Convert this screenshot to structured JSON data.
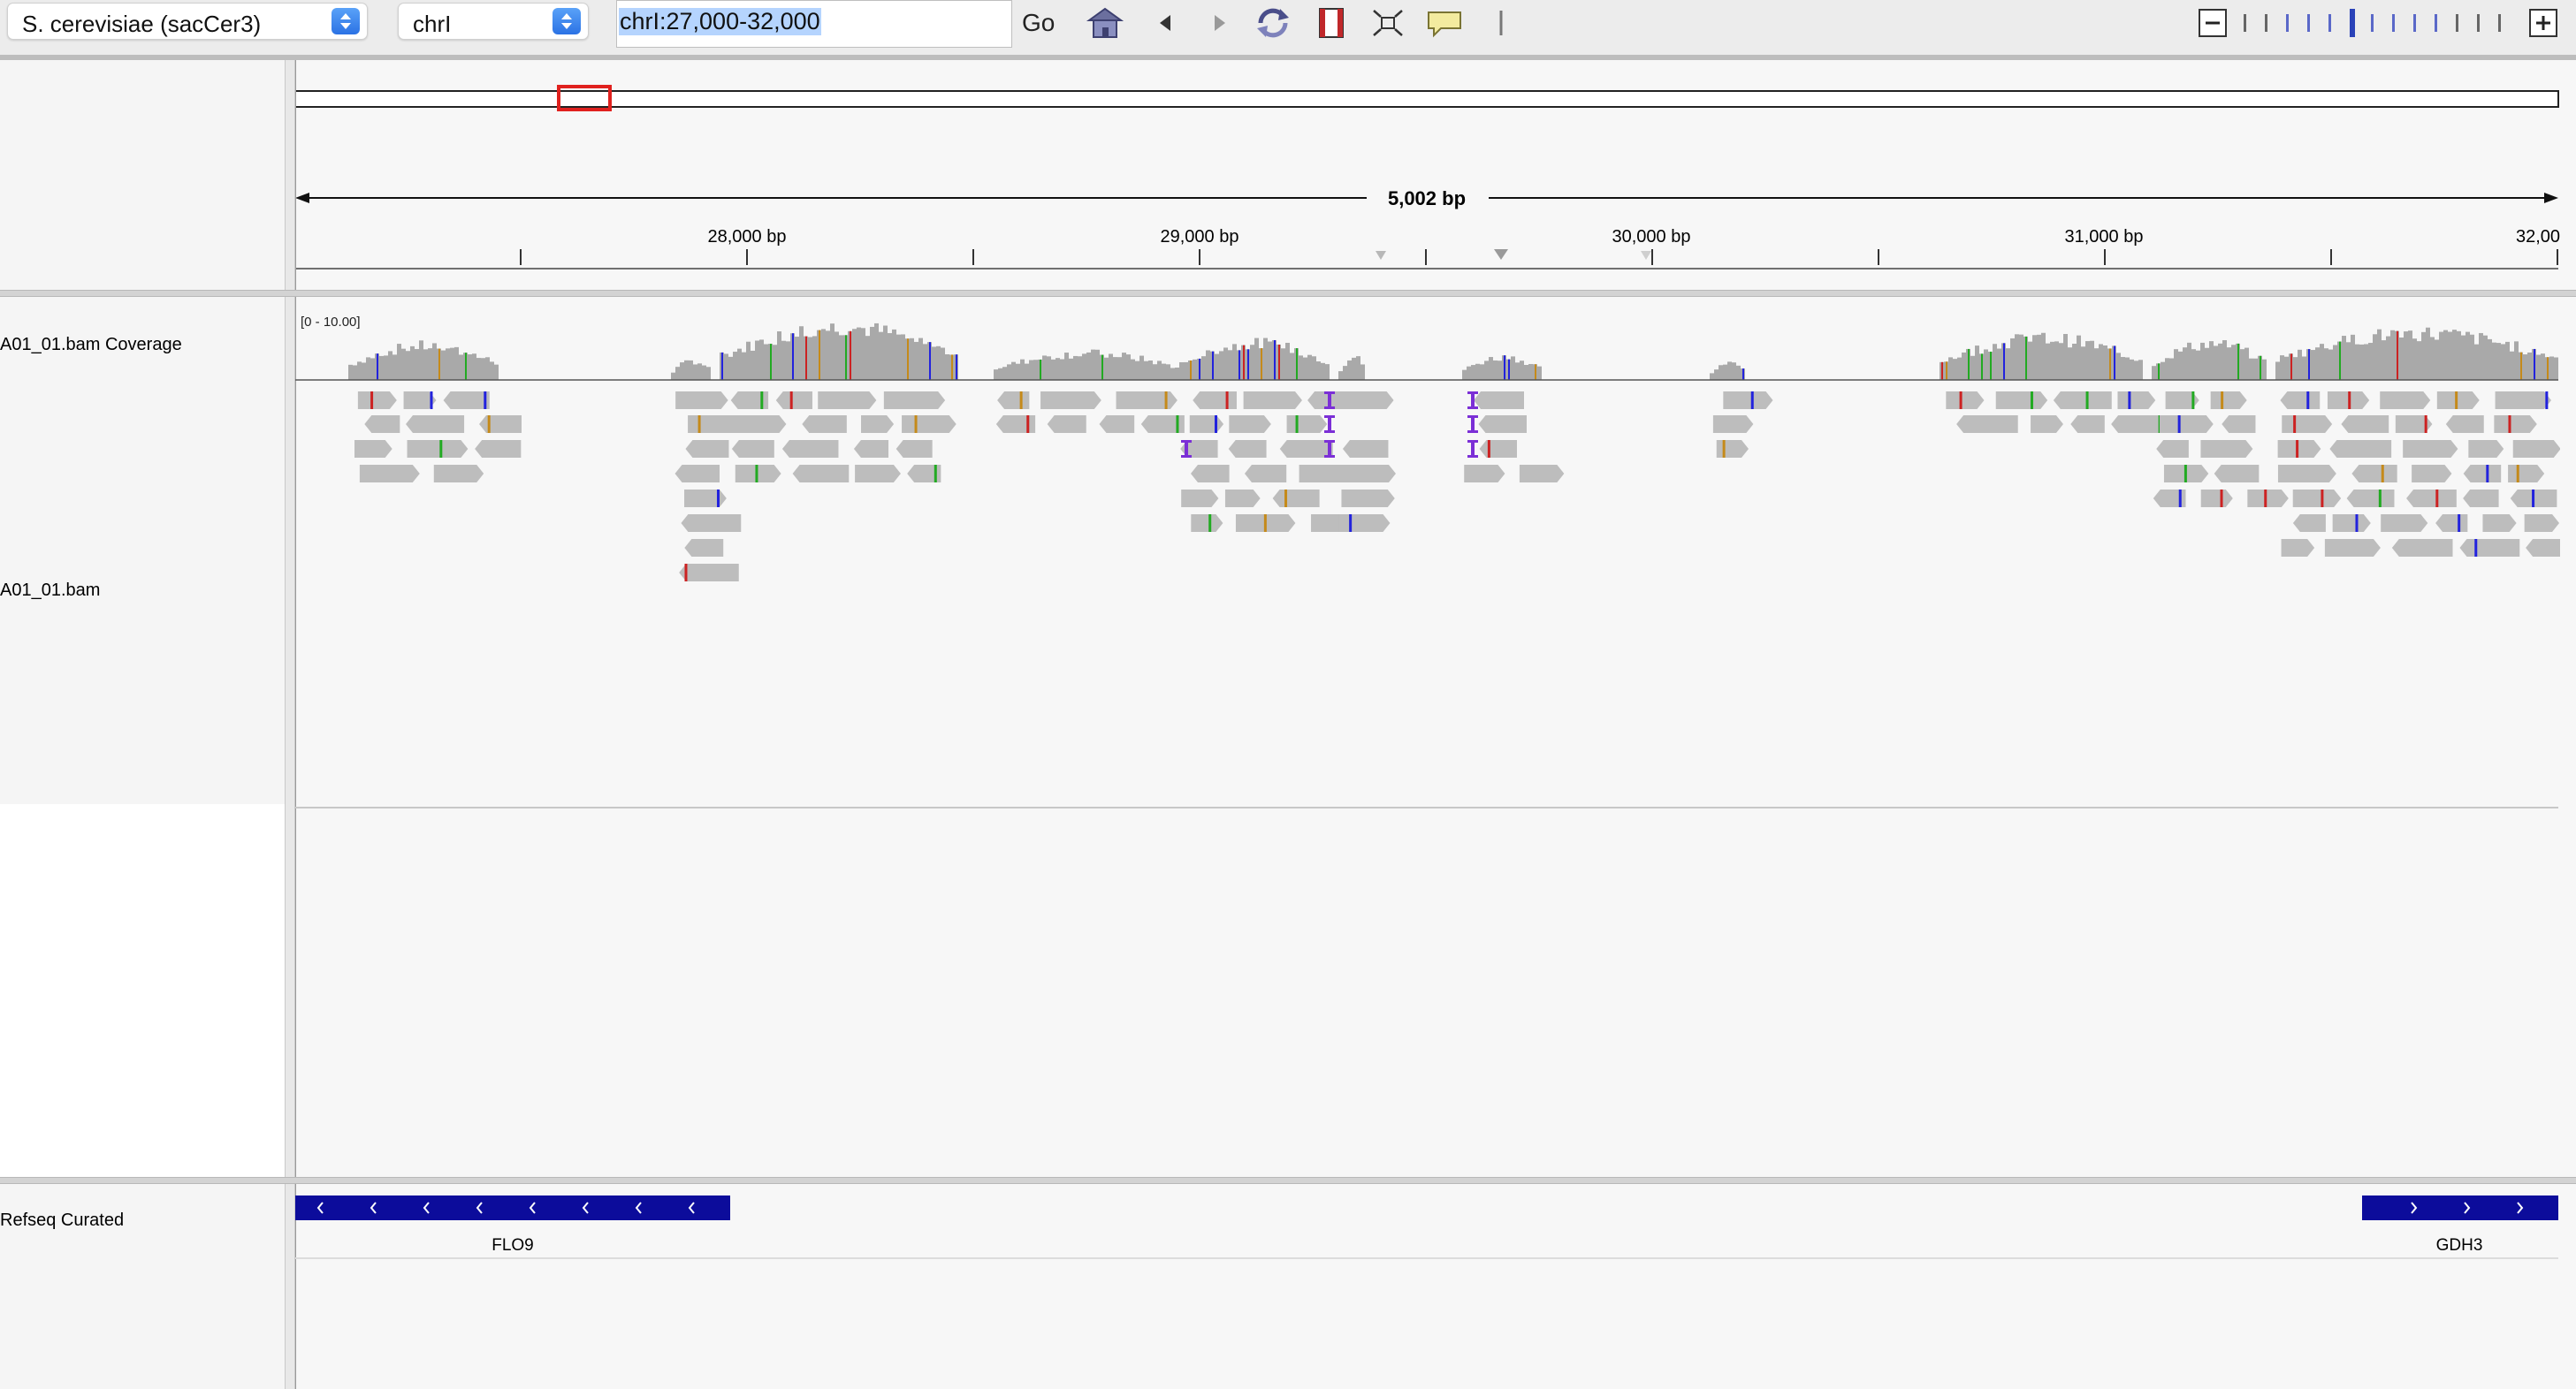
{
  "toolbar": {
    "genome": "S. cerevisiae (sacCer3)",
    "chromosome": "chrI",
    "locus": "chrI:27,000-32,000",
    "go": "Go"
  },
  "ruler": {
    "span": "5,002 bp",
    "ticks": [
      "28,000 bp",
      "29,000 bp",
      "30,000 bp",
      "31,000 bp",
      "32,00"
    ]
  },
  "tracks": {
    "coverage_label": "A01_01.bam Coverage",
    "coverage_range": "[0 - 10.00]",
    "alignment_label": "A01_01.bam",
    "refseq_label": "Refseq Curated"
  },
  "genes": [
    {
      "name": "FLO9",
      "strand": "-"
    },
    {
      "name": "GDH3",
      "strand": "+"
    }
  ],
  "colors": {
    "read": "#bdbdbd",
    "coverage": "#a9a9a9",
    "gene": "#0c0c9b",
    "mismatch_A": "#22aa22",
    "mismatch_C": "#2222dd",
    "mismatch_T": "#cc2222",
    "mismatch_G": "#c58a1a",
    "insertion": "#7b2fd6",
    "viewport_box": "#e0211e"
  }
}
